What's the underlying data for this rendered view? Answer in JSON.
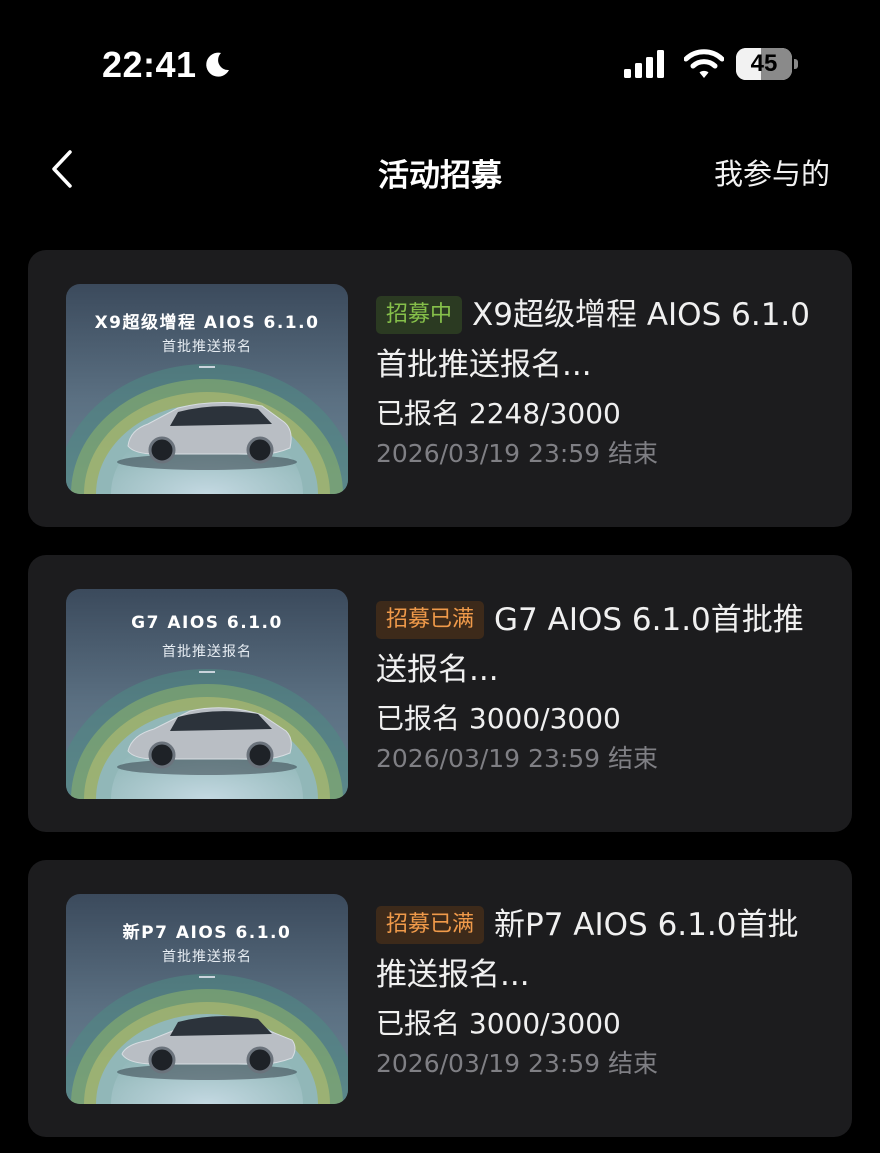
{
  "status_bar": {
    "time": "22:41",
    "battery_level": "45",
    "battery_fraction": 0.45,
    "icons": [
      "moon-icon",
      "signal-icon",
      "wifi-icon",
      "battery-icon"
    ]
  },
  "nav": {
    "back_icon": "chevron-left-icon",
    "title": "活动招募",
    "right_label": "我参与的"
  },
  "colors": {
    "background": "#000000",
    "card": "#1c1c1e",
    "badge_recruiting_text": "#86c04a",
    "badge_full_text": "#f09a4a",
    "deadline_text": "#7f7f84"
  },
  "cards": [
    {
      "thumb_title": "X9超级增程 AIOS 6.1.0",
      "thumb_subtitle": "首批推送报名",
      "badge": "招募中",
      "title": "X9超级增程 AIOS 6.1.0",
      "title_cont": "首批推送报名...",
      "enrolled": "已报名 2248/3000",
      "deadline": "2026/03/19 23:59 结束"
    },
    {
      "thumb_title": "G7 AIOS 6.1.0",
      "thumb_subtitle": "首批推送报名",
      "badge": "招募已满",
      "title": "G7 AIOS 6.1.0首批推",
      "title_cont": "送报名...",
      "enrolled": "已报名 3000/3000",
      "deadline": "2026/03/19 23:59 结束"
    },
    {
      "thumb_title": "新P7 AIOS 6.1.0",
      "thumb_subtitle": "首批推送报名",
      "badge": "招募已满",
      "title": "新P7 AIOS 6.1.0首批",
      "title_cont": "推送报名...",
      "enrolled": "已报名 3000/3000",
      "deadline": "2026/03/19 23:59 结束"
    }
  ]
}
